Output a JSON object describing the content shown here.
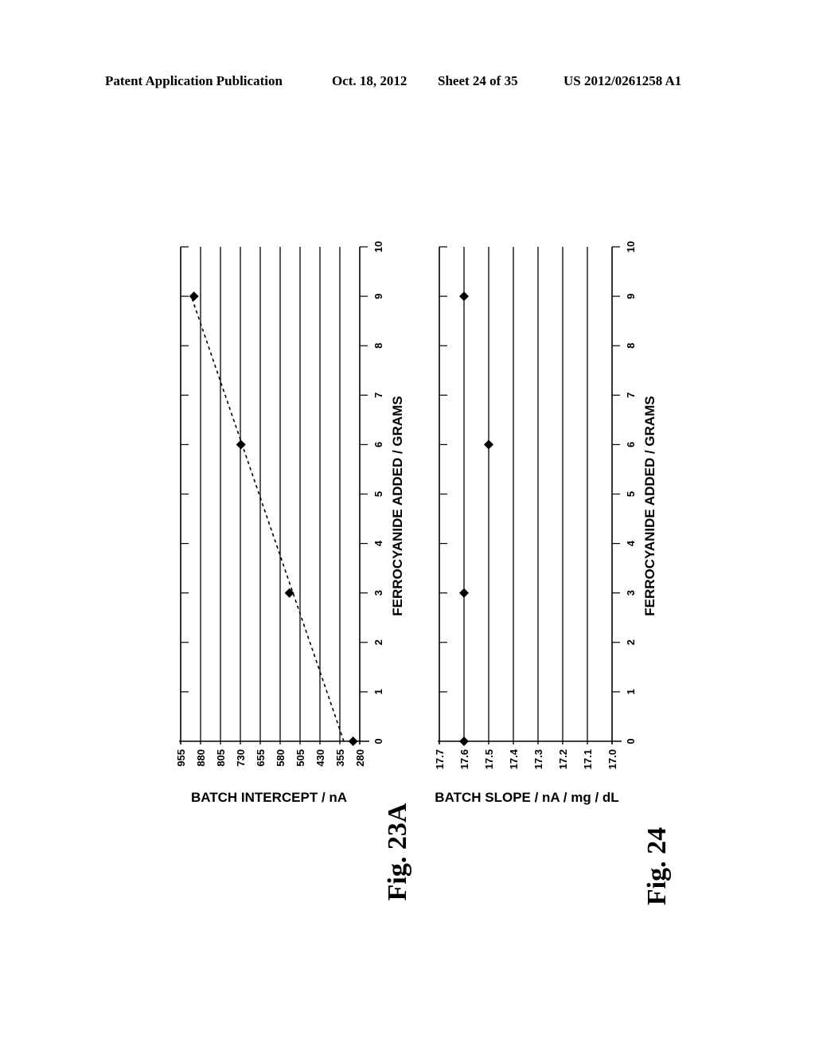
{
  "header": {
    "publication": "Patent Application Publication",
    "date": "Oct. 18, 2012",
    "sheet": "Sheet 24 of 35",
    "number": "US 2012/0261258 A1"
  },
  "chart_data": [
    {
      "type": "scatter",
      "figure_label": "Fig. 23A",
      "title": "",
      "xlabel": "FERROCYANIDE ADDED / GRAMS",
      "ylabel": "BATCH INTERCEPT / nA",
      "xlim": [
        0,
        10
      ],
      "ylim": [
        280,
        955
      ],
      "x_ticks": [
        "0",
        "1",
        "2",
        "3",
        "4",
        "5",
        "6",
        "7",
        "8",
        "9",
        "10"
      ],
      "y_ticks": [
        "955",
        "880",
        "805",
        "730",
        "655",
        "580",
        "505",
        "430",
        "355",
        "280"
      ],
      "grid": true,
      "orientation": "rotated 90° (page landscape)",
      "series": [
        {
          "name": "Batch intercept",
          "marker": "diamond",
          "x": [
            0,
            3,
            6,
            9
          ],
          "y": [
            305,
            545,
            728,
            905
          ]
        }
      ],
      "trendline": {
        "style": "dashed",
        "x": [
          0,
          9
        ],
        "y": [
          340,
          915
        ]
      }
    },
    {
      "type": "scatter",
      "figure_label": "Fig. 24",
      "title": "",
      "xlabel": "FERROCYANIDE ADDED / GRAMS",
      "ylabel": "BATCH SLOPE / nA / mg / dL",
      "xlim": [
        0,
        10
      ],
      "ylim": [
        17.0,
        17.7
      ],
      "x_ticks": [
        "0",
        "1",
        "2",
        "3",
        "4",
        "5",
        "6",
        "7",
        "8",
        "9",
        "10"
      ],
      "y_ticks": [
        "17.7",
        "17.6",
        "17.5",
        "17.4",
        "17.3",
        "17.2",
        "17.1",
        "17.0"
      ],
      "grid": true,
      "orientation": "rotated 90° (page landscape)",
      "series": [
        {
          "name": "Batch slope",
          "marker": "diamond",
          "x": [
            0,
            3,
            6,
            9
          ],
          "y": [
            17.6,
            17.6,
            17.5,
            17.6
          ]
        }
      ]
    }
  ]
}
